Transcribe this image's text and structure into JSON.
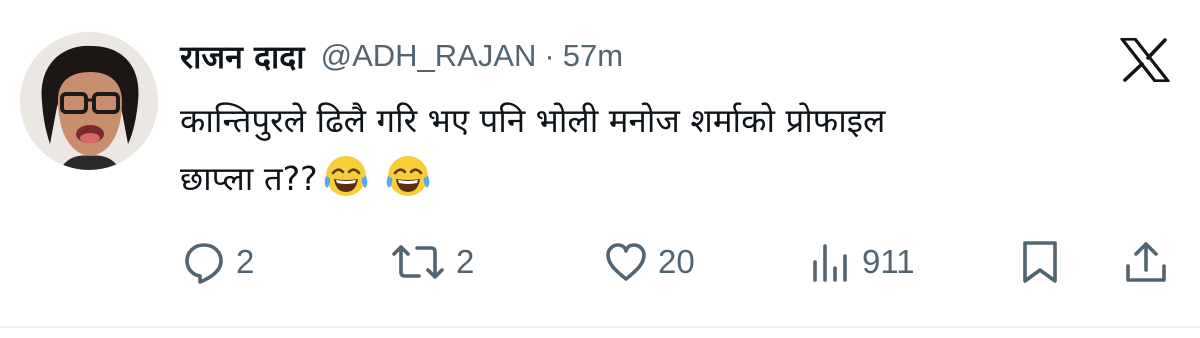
{
  "tweet": {
    "display_name": "राजन दादा",
    "handle": "@ADH_RAJAN",
    "separator": "·",
    "time": "57m",
    "text_line1": "कान्तिपुरले ढिलै गरि भए पनि भोली मनोज शर्माको प्रोफाइल",
    "text_line2": "छाप्ला त??",
    "emojis": [
      "face-with-tears-of-joy",
      "face-with-tears-of-joy"
    ]
  },
  "actions": {
    "reply_count": "2",
    "retweet_count": "2",
    "like_count": "20",
    "views_count": "911"
  },
  "colors": {
    "text_primary": "#0f1419",
    "text_secondary": "#536471",
    "icon": "#536471",
    "background": "#ffffff",
    "divider": "#eff3f4"
  }
}
